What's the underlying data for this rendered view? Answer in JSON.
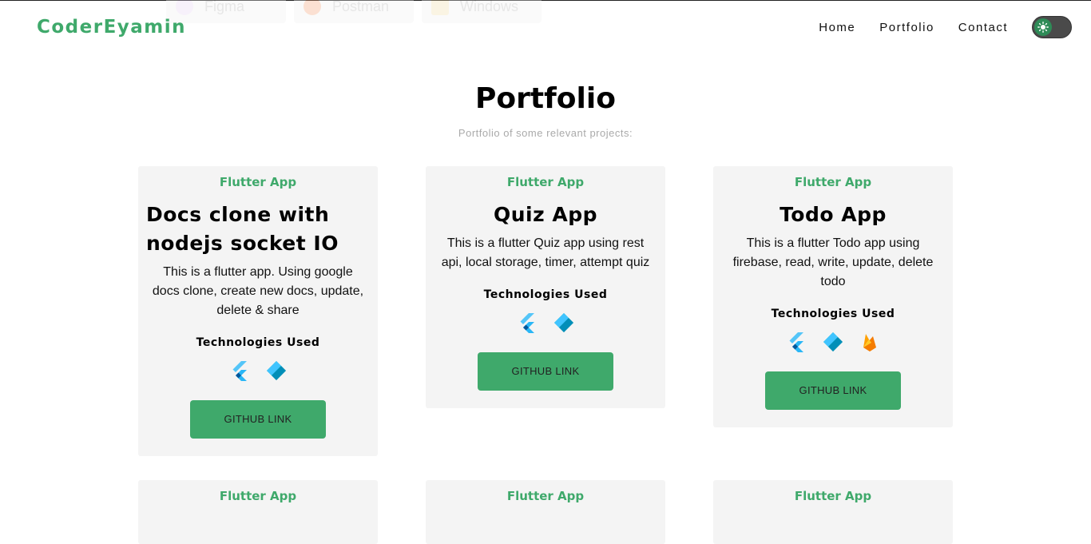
{
  "ghost_skills": [
    "Figma",
    "Postman",
    "Windows"
  ],
  "nav": {
    "brand": "CoderEyamin",
    "links": [
      "Home",
      "Portfolio",
      "Contact"
    ]
  },
  "section": {
    "title": "Portfolio",
    "subtitle": "Portfolio of some relevant projects:"
  },
  "cards": [
    {
      "category": "Flutter App",
      "title": "Docs clone with nodejs socket IO",
      "description": "This is a flutter app. Using google docs clone, create new docs, update, delete & share",
      "tech_heading": "Technologies Used",
      "tech": [
        "flutter-icon",
        "dart-icon"
      ],
      "button": "GITHUB LINK"
    },
    {
      "category": "Flutter App",
      "title": "Quiz App",
      "description": "This is a flutter Quiz app using rest api, local storage, timer, attempt quiz",
      "tech_heading": "Technologies Used",
      "tech": [
        "flutter-icon",
        "dart-icon"
      ],
      "button": "GITHUB LINK"
    },
    {
      "category": "Flutter App",
      "title": "Todo App",
      "description": "This is a flutter Todo app using firebase, read, write, update, delete todo",
      "tech_heading": "Technologies Used",
      "tech": [
        "flutter-icon",
        "dart-icon",
        "firebase-icon"
      ],
      "button": "GITHUB LINK"
    },
    {
      "category": "Flutter App"
    },
    {
      "category": "Flutter App"
    },
    {
      "category": "Flutter App"
    }
  ],
  "colors": {
    "accent": "#3fa96b",
    "card_bg": "#f4f4f4"
  }
}
